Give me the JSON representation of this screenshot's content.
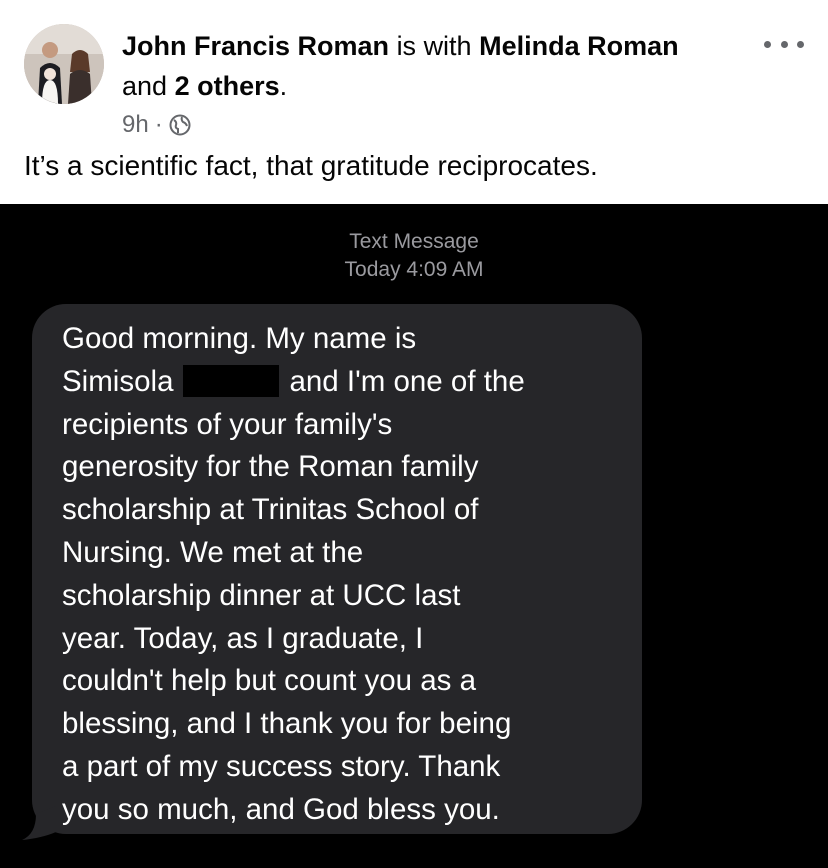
{
  "post": {
    "author": "John Francis Roman",
    "with_text": "is with",
    "tagged": "Melinda Roman",
    "and_text": "and",
    "others": "2 others",
    "period": ".",
    "time": "9h",
    "separator": "·",
    "privacy_icon": "globe-icon",
    "more_icon": "more-horizontal-icon",
    "caption": "It’s a scientific fact, that gratitude reciprocates."
  },
  "message": {
    "kind": "Text Message",
    "timestamp": "Today 4:09 AM",
    "lines": [
      "Good morning. My name is",
      "Simisola",
      "and I'm one of the",
      "recipients of your family's",
      "generosity for the Roman family",
      "scholarship at Trinitas School of",
      "Nursing. We met at the",
      "scholarship dinner at UCC last",
      "year.  Today, as I graduate, I",
      "couldn't help but count you as a",
      "blessing, and I thank you for being",
      "a part of my success story. Thank",
      "you so much, and God bless you."
    ]
  },
  "colors": {
    "text_primary": "#050505",
    "text_secondary": "#65676b",
    "screenshot_background": "#000000",
    "bubble": "#262629",
    "bubble_text": "#ffffff",
    "meta_text": "#9a9a9f"
  }
}
